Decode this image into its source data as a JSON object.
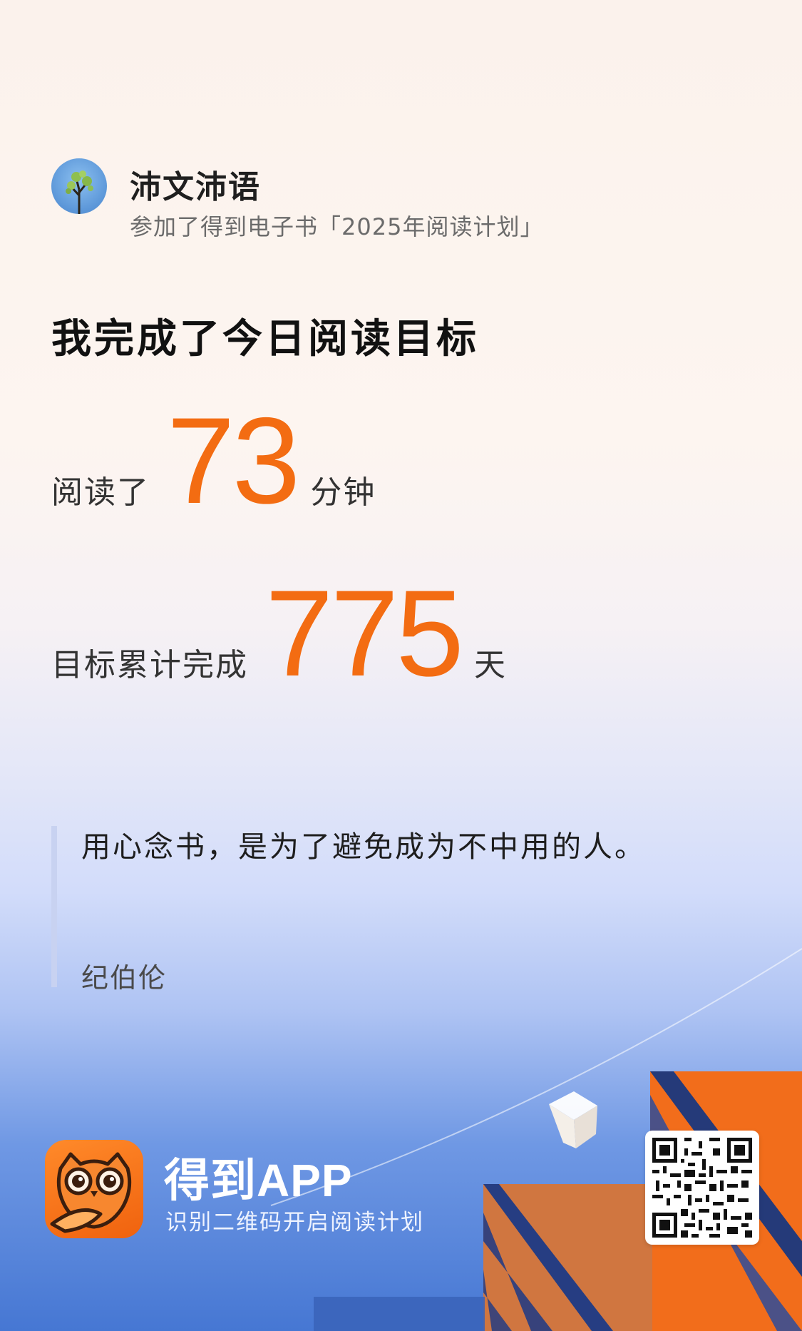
{
  "user": {
    "name": "沛文沛语",
    "activity": "参加了得到电子书「2025年阅读计划」"
  },
  "headline": "我完成了今日阅读目标",
  "stats": {
    "minutes_prefix": "阅读了",
    "minutes_value": "73",
    "minutes_unit": "分钟",
    "days_prefix": "目标累计完成",
    "days_value": "775",
    "days_unit": "天"
  },
  "quote": {
    "text": "用心念书，是为了避免成为不中用的人。",
    "author": "纪伯伦"
  },
  "footer": {
    "app_name": "得到APP",
    "tagline": "识别二维码开启阅读计划"
  },
  "colors": {
    "accent": "#f36c12",
    "app_icon": "#f0620e",
    "footer_blue": "#4677d3"
  },
  "icons": {
    "avatar": "tree-avatar",
    "app_logo": "owl-icon",
    "qr": "qr-code-icon"
  }
}
